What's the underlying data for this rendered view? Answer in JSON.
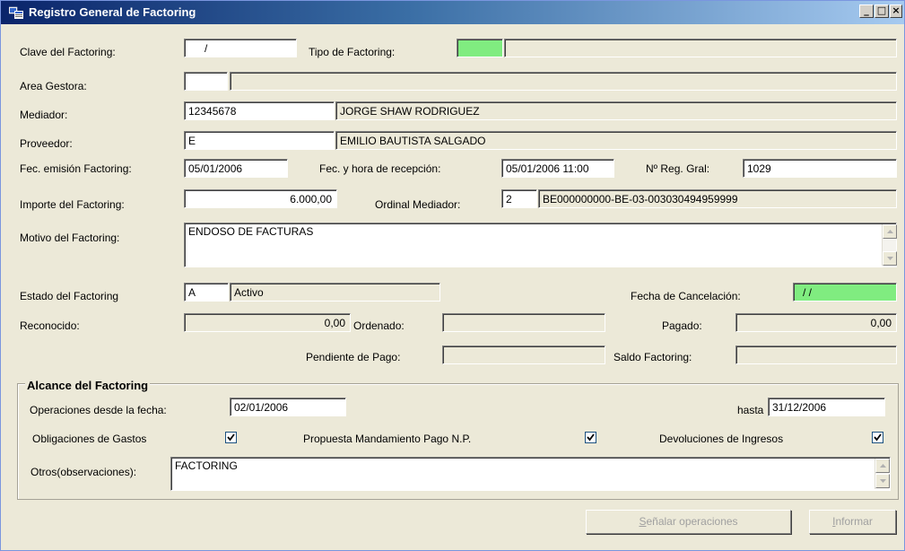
{
  "window": {
    "title": "Registro General de Factoring",
    "min_label": "_",
    "max_label": "□",
    "close_label": "×"
  },
  "labels": {
    "clave": "Clave del Factoring:",
    "tipo": "Tipo de Factoring:",
    "area": "Area Gestora:",
    "mediador": "Mediador:",
    "proveedor": "Proveedor:",
    "fec_emision": "Fec. emisión Factoring:",
    "fec_recepcion": "Fec. y hora de recepción:",
    "nreg": "Nº Reg. Gral:",
    "importe": "Importe del Factoring:",
    "ordinal": "Ordinal Mediador:",
    "motivo": "Motivo del Factoring:",
    "estado": "Estado del Factoring",
    "fecha_cancel": "Fecha de Cancelación:",
    "reconocido": "Reconocido:",
    "ordenado": "Ordenado:",
    "pagado": "Pagado:",
    "pendiente": "Pendiente de Pago:",
    "saldo": "Saldo Factoring:"
  },
  "values": {
    "clave": "/",
    "tipo_code": "",
    "tipo_desc": "",
    "area_code": "",
    "area_desc": "",
    "mediador_code": "12345678",
    "mediador_name": "JORGE SHAW RODRIGUEZ",
    "proveedor_code": "E",
    "proveedor_name": "EMILIO BAUTISTA SALGADO",
    "fec_emision": "05/01/2006",
    "fec_recepcion": "05/01/2006 11:00",
    "nreg": "1029",
    "importe": "6.000,00",
    "ordinal_code": "2",
    "ordinal_account": "BE000000000-BE-03-003030494959999",
    "motivo": "ENDOSO DE FACTURAS",
    "estado_code": "A",
    "estado_desc": "Activo",
    "fecha_cancel": "/ /",
    "reconocido": "0,00",
    "ordenado": "",
    "pagado": "0,00",
    "pendiente": "",
    "saldo": ""
  },
  "alcance": {
    "title": "Alcance del Factoring",
    "desde_label": "Operaciones desde la fecha:",
    "desde": "02/01/2006",
    "hasta_label": "hasta",
    "hasta": "31/12/2006",
    "obligaciones_label": "Obligaciones de Gastos",
    "obligaciones_checked": true,
    "propuesta_label": "Propuesta Mandamiento Pago N.P.",
    "propuesta_checked": true,
    "devoluciones_label": "Devoluciones de Ingresos",
    "devoluciones_checked": true,
    "otros_label": "Otros(observaciones):",
    "otros": "FACTORING"
  },
  "buttons": {
    "senalar_u": "S",
    "senalar_rest": "eñalar operaciones",
    "informar_u": "I",
    "informar_rest": "nformar"
  },
  "colors": {
    "highlight_green": "#80ec80",
    "window_bg": "#ece9d8"
  }
}
